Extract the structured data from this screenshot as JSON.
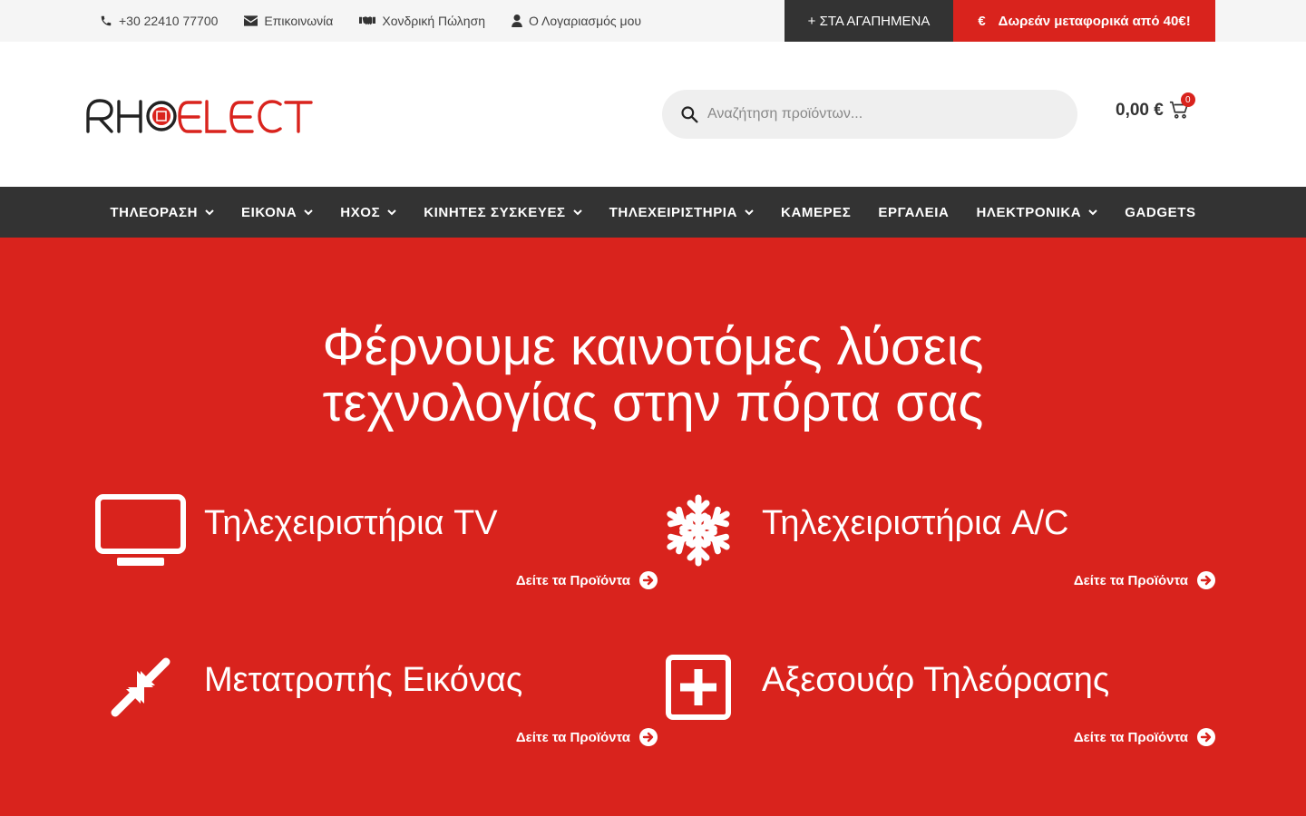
{
  "topbar": {
    "phone": "+30 22410 77700",
    "contact": "Επικοινωνία",
    "wholesale": "Χονδρική Πώληση",
    "account": "Ο Λογαριασμός μου",
    "favorites": "+ ΣΤΑ ΑΓΑΠΗΜΕΝΑ",
    "shipping_symbol": "€",
    "shipping": "Δωρεάν μεταφορικά από 40€!"
  },
  "header": {
    "logo": "RHOELECT",
    "search_placeholder": "Αναζήτηση προϊόντων...",
    "cart_total": "0,00 €",
    "cart_count": "0"
  },
  "nav": {
    "items": [
      {
        "label": "ΤΗΛΕΟΡΑΣΗ",
        "dropdown": true
      },
      {
        "label": "ΕΙΚΟΝΑ",
        "dropdown": true
      },
      {
        "label": "ΗΧΟΣ",
        "dropdown": true
      },
      {
        "label": "ΚΙΝΗΤΕΣ ΣΥΣΚΕΥΕΣ",
        "dropdown": true
      },
      {
        "label": "ΤΗΛΕΧΕΙΡΙΣΤΗΡΙΑ",
        "dropdown": true
      },
      {
        "label": "ΚΑΜΕΡΕΣ",
        "dropdown": false
      },
      {
        "label": "ΕΡΓΑΛΕΙΑ",
        "dropdown": false
      },
      {
        "label": "ΗΛΕΚΤΡΟΝΙΚΑ",
        "dropdown": true
      },
      {
        "label": "GADGETS",
        "dropdown": false
      }
    ]
  },
  "hero": {
    "title_line1": "Φέρνουμε καινοτόμες λύσεις",
    "title_line2": "τεχνολογίας στην πόρτα σας",
    "categories": [
      {
        "title": "Τηλεχειριστήρια TV",
        "link": "Δείτε τα Προϊόντα",
        "icon": "tv-icon"
      },
      {
        "title": "Τηλεχειριστήρια A/C",
        "link": "Δείτε τα Προϊόντα",
        "icon": "snowflake-icon"
      },
      {
        "title": "Μετατροπής Εικόνας",
        "link": "Δείτε τα Προϊόντα",
        "icon": "compress-arrows-icon"
      },
      {
        "title": "Αξεσουάρ Τηλεόρασης",
        "link": "Δείτε τα Προϊόντα",
        "icon": "plus-square-icon"
      }
    ]
  },
  "colors": {
    "brand_red": "#d9231d",
    "dark": "#333333",
    "topbar_bg": "#f5f5f5",
    "search_bg": "#efefef"
  }
}
